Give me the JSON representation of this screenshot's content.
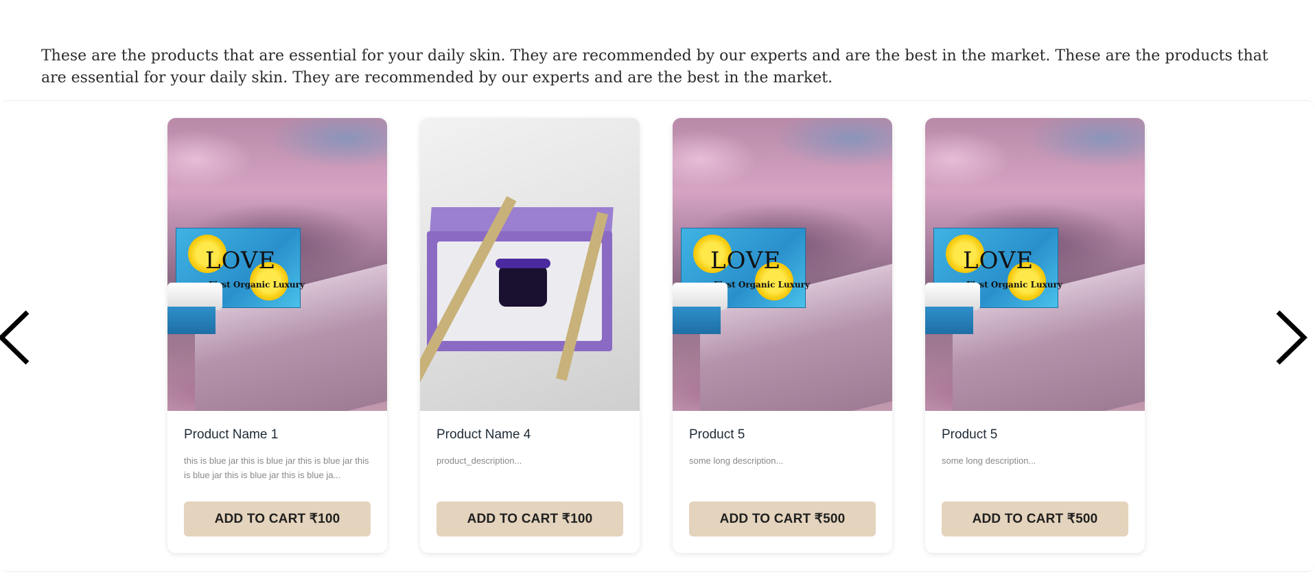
{
  "intro_text": "These are the products that are essential for your daily skin. They are recommended by our experts and are the best in the market. These are the products that are essential for your daily skin. They are recommended by our experts and are the best in the market.",
  "carousel": {
    "prev_icon": "chevron-left-icon",
    "next_icon": "chevron-right-icon",
    "products": [
      {
        "title": "Product Name 1",
        "description": "this is blue jar this is blue jar this is blue jar this is blue jar this is blue jar this is blue ja...",
        "button": "ADD TO CART ₹100",
        "image": "product-photo-lemon-box"
      },
      {
        "title": "Product Name 4",
        "description": "product_description...",
        "button": "ADD TO CART ₹100",
        "image": "product-photo-gift-box"
      },
      {
        "title": "Product 5",
        "description": "some long description...",
        "button": "ADD TO CART ₹500",
        "image": "product-photo-lemon-box"
      },
      {
        "title": "Product 5",
        "description": "some long description...",
        "button": "ADD TO CART ₹500",
        "image": "product-photo-lemon-box"
      }
    ]
  },
  "colors": {
    "button_bg": "#e4d3bd",
    "title_text": "#1e2a36",
    "desc_text": "#888888"
  }
}
